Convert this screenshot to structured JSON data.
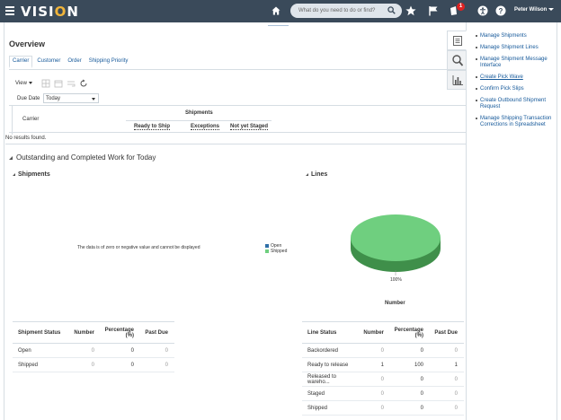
{
  "header": {
    "logo_prefix": "VISI",
    "logo_o": "O",
    "logo_suffix": "N",
    "search_placeholder": "What do you need to do or find?",
    "notifications_count": "1",
    "user_name": "Peter Wilson",
    "icons": [
      "menu-icon",
      "home-icon",
      "search-icon",
      "star-icon",
      "flag-icon",
      "bell-icon",
      "accessibility-icon",
      "help-icon"
    ]
  },
  "overview": {
    "title": "Overview",
    "tabs": [
      "Carrier",
      "Customer",
      "Order",
      "Shipping Priority"
    ],
    "active_tab": "Carrier",
    "toolbar": {
      "view_label": "View"
    },
    "due_date": {
      "label": "Due Date",
      "value": "Today"
    },
    "carrier_table": {
      "carrier_header": "Carrier",
      "group_header": "Shipments",
      "columns": [
        "Ready to Ship",
        "Exceptions",
        "Not yet Staged"
      ],
      "empty_message": "No results found."
    }
  },
  "work": {
    "title": "Outstanding and Completed Work for Today",
    "shipments": {
      "title": "Shipments",
      "no_data_message": "The data is of zero or negative value and cannot be displayed",
      "legend": [
        {
          "label": "Open",
          "color": "#2f6fa8"
        },
        {
          "label": "Shipped",
          "color": "#6fcf7f"
        }
      ],
      "table": {
        "headers": [
          "Shipment Status",
          "Number",
          "Percentage (%)",
          "Past Due"
        ],
        "rows": [
          [
            "Open",
            "0",
            "0",
            "0"
          ],
          [
            "Shipped",
            "0",
            "0",
            "0"
          ]
        ]
      }
    },
    "lines": {
      "title": "Lines",
      "pie_percent_label": "100%",
      "pie_title": "Number",
      "pie_color": "#6fcf7f",
      "table": {
        "headers": [
          "Line Status",
          "Number",
          "Percentage (%)",
          "Past Due"
        ],
        "rows": [
          [
            "Backordered",
            "0",
            "0",
            "0"
          ],
          [
            "Ready to release",
            "1",
            "100",
            "1"
          ],
          [
            "Released to wareho...",
            "0",
            "0",
            "0"
          ],
          [
            "Staged",
            "0",
            "0",
            "0"
          ],
          [
            "Shipped",
            "0",
            "0",
            "0"
          ]
        ]
      }
    }
  },
  "tasks_panel": {
    "items": [
      "Manage Shipments",
      "Manage Shipment Lines",
      "Manage Shipment Message Interface",
      "Create Pick Wave",
      "Confirm Pick Slips",
      "Create Outbound Shipment Request",
      "Manage Shipping Transaction Corrections in Spreadsheet"
    ]
  }
}
